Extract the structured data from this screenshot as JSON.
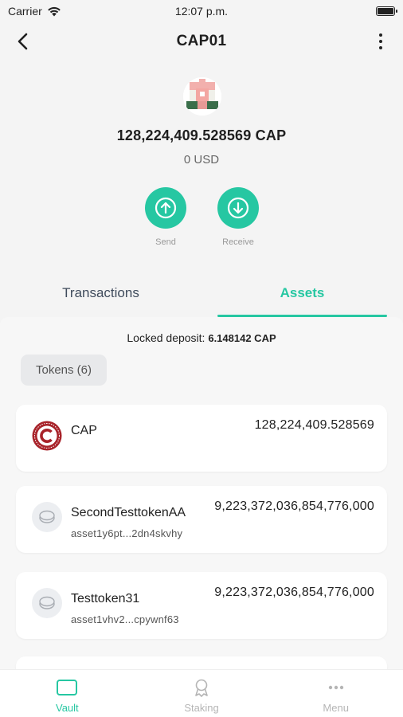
{
  "status": {
    "carrier": "Carrier",
    "time": "12:07 p.m."
  },
  "nav": {
    "title": "CAP01"
  },
  "wallet": {
    "balance": "128,224,409.528569 CAP",
    "fiat": "0 USD"
  },
  "actions": {
    "send": "Send",
    "receive": "Receive"
  },
  "tabs": {
    "transactions": "Transactions",
    "assets": "Assets",
    "active": "Assets"
  },
  "assets": {
    "locked_label": "Locked deposit:",
    "locked_value": "6.148142 CAP",
    "filter_chip": "Tokens (6)",
    "items": [
      {
        "name": "CAP",
        "amount": "128,224,409.528569",
        "icon": "cap-logo-icon"
      },
      {
        "name": "SecondTesttokenAA",
        "id": "asset1y6pt...2dn4skvhy",
        "amount": "9,223,372,036,854,776,000",
        "icon": "coin-icon"
      },
      {
        "name": "Testtoken31",
        "id": "asset1vhv2...cpywnf63",
        "amount": "9,223,372,036,854,776,000",
        "icon": "coin-icon"
      }
    ]
  },
  "bottom_nav": {
    "vault": "Vault",
    "staking": "Staking",
    "menu": "Menu",
    "active": "Vault"
  },
  "colors": {
    "accent": "#26c7a2",
    "cap_logo": "#a8232a"
  }
}
